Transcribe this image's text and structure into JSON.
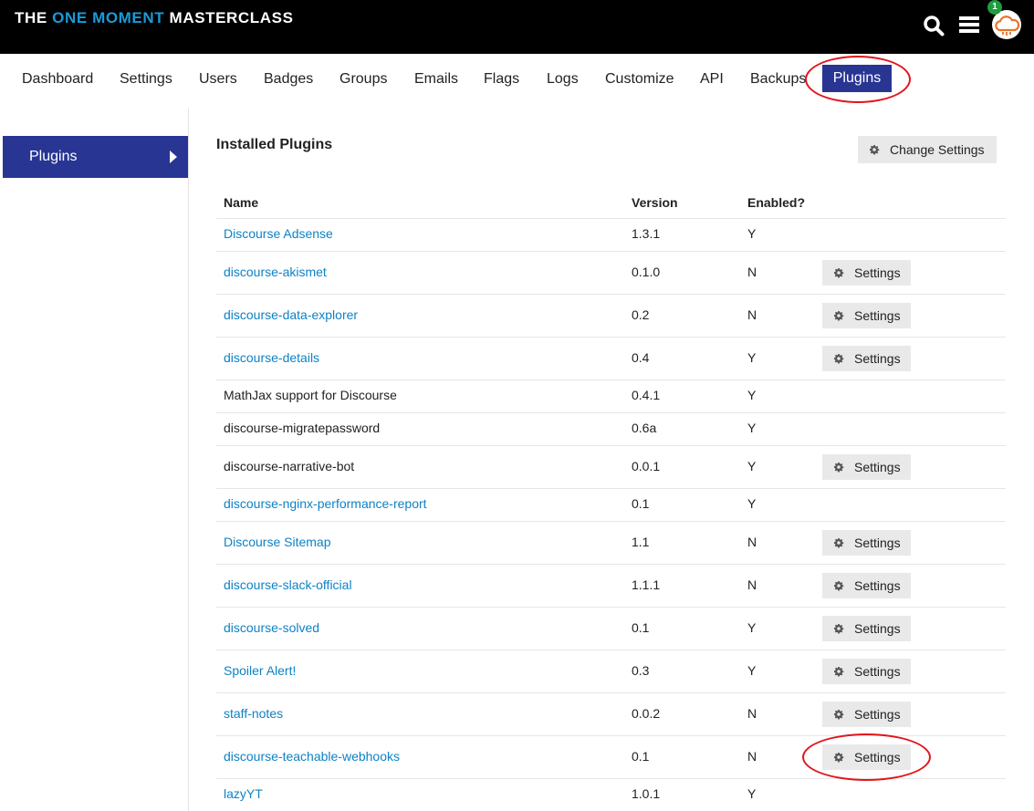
{
  "header": {
    "logo_part1": "THE ",
    "logo_part2": "ONE MOMENT",
    "logo_part3": " MASTERCLASS",
    "notification_count": "1",
    "icons": [
      "search-icon",
      "hamburger-menu-icon",
      "cloud-avatar-icon"
    ]
  },
  "nav": {
    "items": [
      "Dashboard",
      "Settings",
      "Users",
      "Badges",
      "Groups",
      "Emails",
      "Flags",
      "Logs",
      "Customize",
      "API",
      "Backups"
    ],
    "active": "Plugins"
  },
  "sidebar": {
    "item": "Plugins"
  },
  "main": {
    "title": "Installed Plugins",
    "change_settings_label": "Change Settings",
    "columns": {
      "name": "Name",
      "version": "Version",
      "enabled": "Enabled?"
    },
    "settings_label": "Settings",
    "rows": [
      {
        "name": "Discourse Adsense",
        "version": "1.3.1",
        "enabled": "Y",
        "link": true,
        "settings": false
      },
      {
        "name": "discourse-akismet",
        "version": "0.1.0",
        "enabled": "N",
        "link": true,
        "settings": true
      },
      {
        "name": "discourse-data-explorer",
        "version": "0.2",
        "enabled": "N",
        "link": true,
        "settings": true
      },
      {
        "name": "discourse-details",
        "version": "0.4",
        "enabled": "Y",
        "link": true,
        "settings": true
      },
      {
        "name": "MathJax support for Discourse",
        "version": "0.4.1",
        "enabled": "Y",
        "link": false,
        "settings": false
      },
      {
        "name": "discourse-migratepassword",
        "version": "0.6a",
        "enabled": "Y",
        "link": false,
        "settings": false
      },
      {
        "name": "discourse-narrative-bot",
        "version": "0.0.1",
        "enabled": "Y",
        "link": false,
        "settings": true
      },
      {
        "name": "discourse-nginx-performance-report",
        "version": "0.1",
        "enabled": "Y",
        "link": true,
        "settings": false
      },
      {
        "name": "Discourse Sitemap",
        "version": "1.1",
        "enabled": "N",
        "link": true,
        "settings": true
      },
      {
        "name": "discourse-slack-official",
        "version": "1.1.1",
        "enabled": "N",
        "link": true,
        "settings": true
      },
      {
        "name": "discourse-solved",
        "version": "0.1",
        "enabled": "Y",
        "link": true,
        "settings": true
      },
      {
        "name": "Spoiler Alert!",
        "version": "0.3",
        "enabled": "Y",
        "link": true,
        "settings": true
      },
      {
        "name": "staff-notes",
        "version": "0.0.2",
        "enabled": "N",
        "link": true,
        "settings": true
      },
      {
        "name": "discourse-teachable-webhooks",
        "version": "0.1",
        "enabled": "N",
        "link": true,
        "settings": true
      },
      {
        "name": "lazyYT",
        "version": "1.0.1",
        "enabled": "Y",
        "link": true,
        "settings": false
      }
    ]
  },
  "colors": {
    "header_bg": "#000000",
    "accent": "#283593",
    "link": "#0e82c5",
    "annotation": "#e2161c",
    "logo_highlight": "#1a9ad9"
  }
}
